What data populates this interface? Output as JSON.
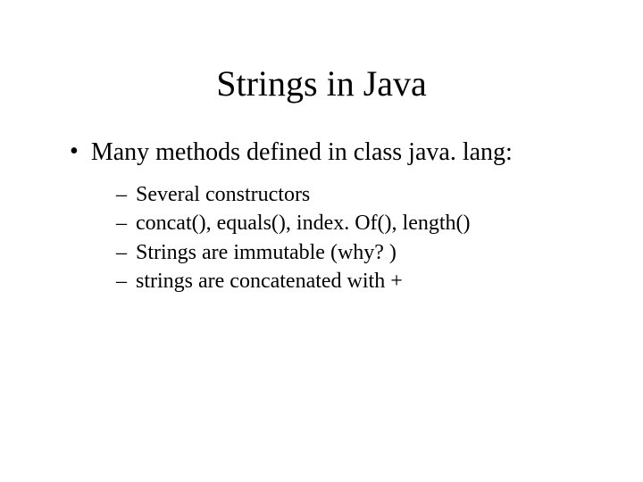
{
  "title": "Strings in Java",
  "bullet": {
    "marker": "•",
    "text": "Many methods defined in class java. lang:"
  },
  "subbullets": {
    "marker": "–",
    "items": [
      "Several constructors",
      "concat(), equals(), index. Of(), length()",
      "Strings are immutable (why? )",
      "strings are concatenated with +"
    ]
  }
}
